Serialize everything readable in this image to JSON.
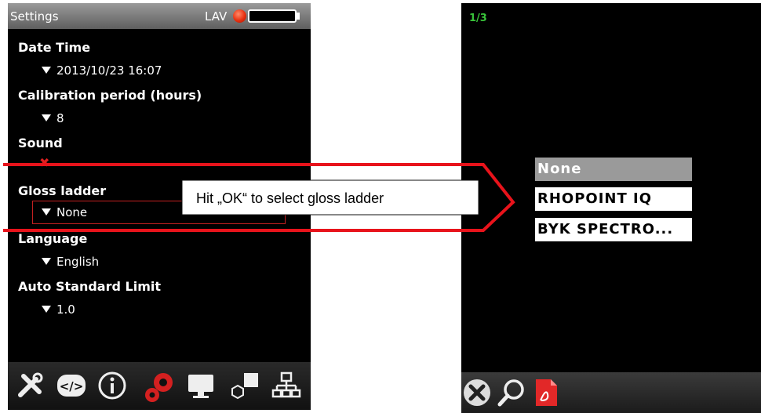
{
  "left_device": {
    "titlebar": {
      "title": "Settings",
      "indicator": "LAV"
    },
    "settings": [
      {
        "label": "Date Time",
        "value": "2013/10/23 16:07"
      },
      {
        "label": "Calibration period (hours)",
        "value": "8"
      },
      {
        "label": "Sound",
        "value_icon": "red-x-icon"
      },
      {
        "label": "Gloss ladder",
        "value": "None"
      },
      {
        "label": "Language",
        "value": "English"
      },
      {
        "label": "Auto Standard Limit",
        "value": "1.0"
      }
    ],
    "toolbar_icons": [
      "tools-icon",
      "code-icon",
      "info-icon",
      "gears-icon",
      "monitor-icon",
      "shapes-icon",
      "network-icon"
    ]
  },
  "callout": {
    "text": "Hit „OK“ to select gloss ladder",
    "color": "#e8131b"
  },
  "right_device": {
    "page_counter": "1/3",
    "options": [
      "None",
      "RHOPOINT IQ",
      "BYK SPECTRO..."
    ],
    "selected_index": 0,
    "toolbar_icons": [
      "close-icon",
      "search-icon",
      "pdf-icon"
    ]
  }
}
